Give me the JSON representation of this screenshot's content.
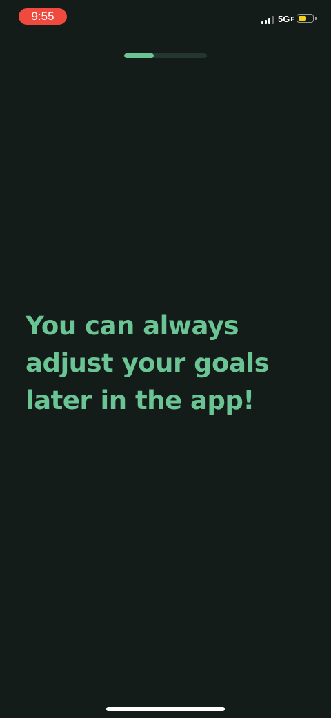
{
  "status_bar": {
    "time": "9:55",
    "network": "5G",
    "network_suffix": "E",
    "signal_bars": 3,
    "signal_max": 4,
    "battery_level": 0.6
  },
  "onboarding": {
    "progress": 0.36,
    "message": "You can always adjust your goals later in the app!"
  },
  "colors": {
    "background": "#141c1a",
    "accent": "#6bc494",
    "time_pill": "#f04a3f",
    "battery": "#f2d21b"
  }
}
